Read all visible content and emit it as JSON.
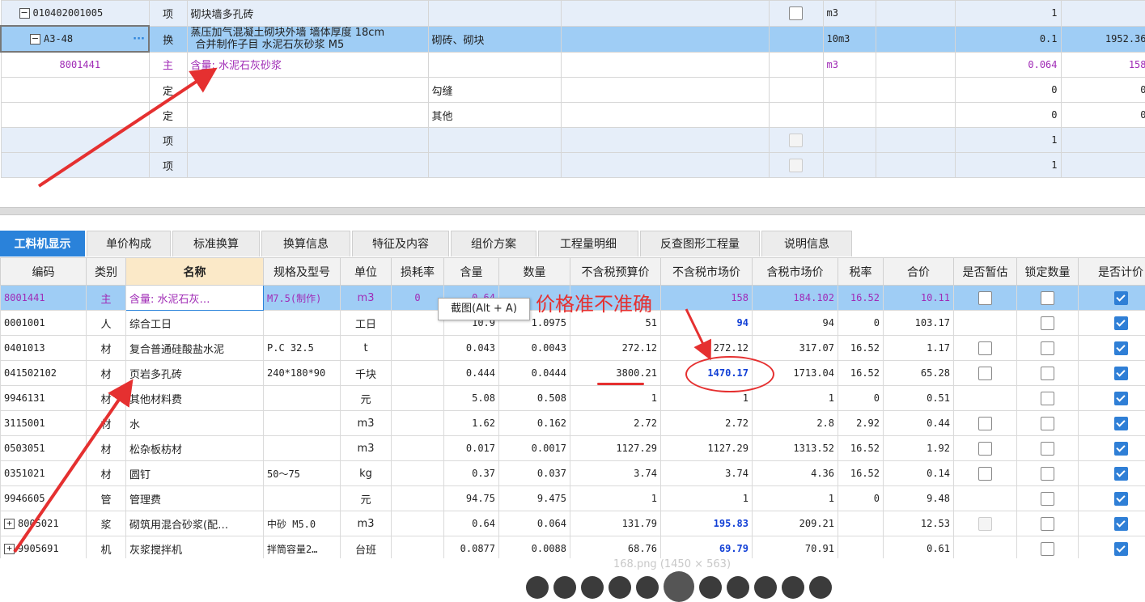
{
  "top_rows": [
    {
      "code": "010402001005",
      "type": "项",
      "name": "砌块墙多孔砖",
      "spec": "",
      "unit": "m3",
      "qty": "1",
      "price": ""
    },
    {
      "code": "A3-48",
      "type": "换",
      "name1": "蒸压加气混凝土砌块外墙 墙体厚度 18cm",
      "name2": "合并制作子目 水泥石灰砂浆 M5",
      "spec": "砌砖、砌块",
      "unit": "10m3",
      "qty": "0.1",
      "price": "1952.36"
    },
    {
      "code": "8001441",
      "type": "主",
      "name": "含量: 水泥石灰砂浆",
      "spec": "",
      "unit": "m3",
      "qty": "0.064",
      "price": "158"
    },
    {
      "code": "",
      "type": "定",
      "name": "",
      "spec": "勾缝",
      "unit": "",
      "qty": "0",
      "price": "0"
    },
    {
      "code": "",
      "type": "定",
      "name": "",
      "spec": "其他",
      "unit": "",
      "qty": "0",
      "price": "0"
    },
    {
      "code": "",
      "type": "项",
      "name": "",
      "spec": "",
      "unit": "",
      "qty": "1",
      "price": ""
    },
    {
      "code": "",
      "type": "项",
      "name": "",
      "spec": "",
      "unit": "",
      "qty": "1",
      "price": ""
    }
  ],
  "tabs": [
    "工料机显示",
    "单价构成",
    "标准换算",
    "换算信息",
    "特征及内容",
    "组价方案",
    "工程量明细",
    "反查图形工程量",
    "说明信息"
  ],
  "headers": [
    "编码",
    "类别",
    "名称",
    "规格及型号",
    "单位",
    "损耗率",
    "含量",
    "数量",
    "不含税预算价",
    "不含税市场价",
    "含税市场价",
    "税率",
    "合价",
    "是否暂估",
    "锁定数量",
    "是否计价"
  ],
  "rows": [
    {
      "code": "8001441",
      "cat": "主",
      "name": "含量: 水泥石灰…",
      "spec": "M7.5(制作)",
      "unit": "m3",
      "loss": "0",
      "content": "0.64",
      "qty": "",
      "budget": "",
      "market": "158",
      "market_tax": "184.102",
      "rate": "16.52",
      "total": "10.11"
    },
    {
      "code": "0001001",
      "cat": "人",
      "name": "综合工日",
      "spec": "",
      "unit": "工日",
      "loss": "",
      "content": "10.9",
      "qty": "1.0975",
      "budget": "51",
      "market": "94",
      "market_tax": "94",
      "rate": "0",
      "total": "103.17"
    },
    {
      "code": "0401013",
      "cat": "材",
      "name": "复合普通硅酸盐水泥",
      "spec": "P.C 32.5",
      "unit": "t",
      "loss": "",
      "content": "0.043",
      "qty": "0.0043",
      "budget": "272.12",
      "market": "272.12",
      "market_tax": "317.07",
      "rate": "16.52",
      "total": "1.17"
    },
    {
      "code": "041502102",
      "cat": "材",
      "name": "页岩多孔砖",
      "spec": "240*180*90",
      "unit": "千块",
      "loss": "",
      "content": "0.444",
      "qty": "0.0444",
      "budget": "3800.21",
      "market": "1470.17",
      "market_tax": "1713.04",
      "rate": "16.52",
      "total": "65.28"
    },
    {
      "code": "9946131",
      "cat": "材",
      "name": "其他材料费",
      "spec": "",
      "unit": "元",
      "loss": "",
      "content": "5.08",
      "qty": "0.508",
      "budget": "1",
      "market": "1",
      "market_tax": "1",
      "rate": "0",
      "total": "0.51"
    },
    {
      "code": "3115001",
      "cat": "材",
      "name": "水",
      "spec": "",
      "unit": "m3",
      "loss": "",
      "content": "1.62",
      "qty": "0.162",
      "budget": "2.72",
      "market": "2.72",
      "market_tax": "2.8",
      "rate": "2.92",
      "total": "0.44"
    },
    {
      "code": "0503051",
      "cat": "材",
      "name": "松杂板枋材",
      "spec": "",
      "unit": "m3",
      "loss": "",
      "content": "0.017",
      "qty": "0.0017",
      "budget": "1127.29",
      "market": "1127.29",
      "market_tax": "1313.52",
      "rate": "16.52",
      "total": "1.92"
    },
    {
      "code": "0351021",
      "cat": "材",
      "name": "圆钉",
      "spec": "50～75",
      "unit": "kg",
      "loss": "",
      "content": "0.37",
      "qty": "0.037",
      "budget": "3.74",
      "market": "3.74",
      "market_tax": "4.36",
      "rate": "16.52",
      "total": "0.14"
    },
    {
      "code": "9946605",
      "cat": "管",
      "name": "管理费",
      "spec": "",
      "unit": "元",
      "loss": "",
      "content": "94.75",
      "qty": "9.475",
      "budget": "1",
      "market": "1",
      "market_tax": "1",
      "rate": "0",
      "total": "9.48"
    },
    {
      "code": "8005021",
      "cat": "浆",
      "name": "砌筑用混合砂浆(配…",
      "spec": "中砂 M5.0",
      "unit": "m3",
      "loss": "",
      "content": "0.64",
      "qty": "0.064",
      "budget": "131.79",
      "market": "195.83",
      "market_tax": "209.21",
      "rate": "",
      "total": "12.53"
    },
    {
      "code": "9905691",
      "cat": "机",
      "name": "灰浆搅拌机",
      "spec": "拌筒容量2…",
      "unit": "台班",
      "loss": "",
      "content": "0.0877",
      "qty": "0.0088",
      "budget": "68.76",
      "market": "69.79",
      "market_tax": "70.91",
      "rate": "",
      "total": "0.61"
    }
  ],
  "tooltip": "截图(Alt + A)",
  "annotation": "价格准不准确",
  "caption": "168.png (1450 × 563)",
  "colors": {
    "accent": "#2a82da",
    "annotation_red": "#e53030",
    "selected_row": "#9fcdf5",
    "highlight_blue": "#1240d6"
  }
}
